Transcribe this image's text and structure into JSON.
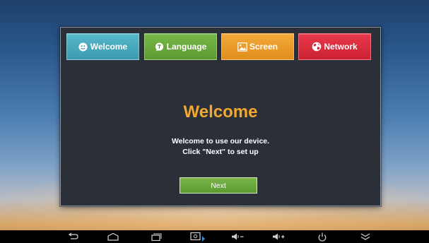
{
  "tabs": [
    {
      "label": "Welcome",
      "icon": "smiley-icon",
      "color": "#48aabd"
    },
    {
      "label": "Language",
      "icon": "speech-bubble-icon",
      "color": "#6aa93c"
    },
    {
      "label": "Screen",
      "icon": "image-icon",
      "color": "#ee9c2a"
    },
    {
      "label": "Network",
      "icon": "globe-icon",
      "color": "#dd2e40"
    }
  ],
  "main": {
    "title": "Welcome",
    "line1": "Welcome to use our device.",
    "line2": "Click \"Next\" to set up",
    "next_label": "Next"
  },
  "navbar": {
    "buttons": [
      "back-icon",
      "home-icon",
      "recent-apps-icon",
      "screenshot-icon",
      "volume-down-icon",
      "volume-up-icon",
      "power-icon",
      "collapse-icon"
    ]
  },
  "colors": {
    "title": "#f2a72e",
    "panel": "#2b3038",
    "next_button": "#6aa93c"
  }
}
